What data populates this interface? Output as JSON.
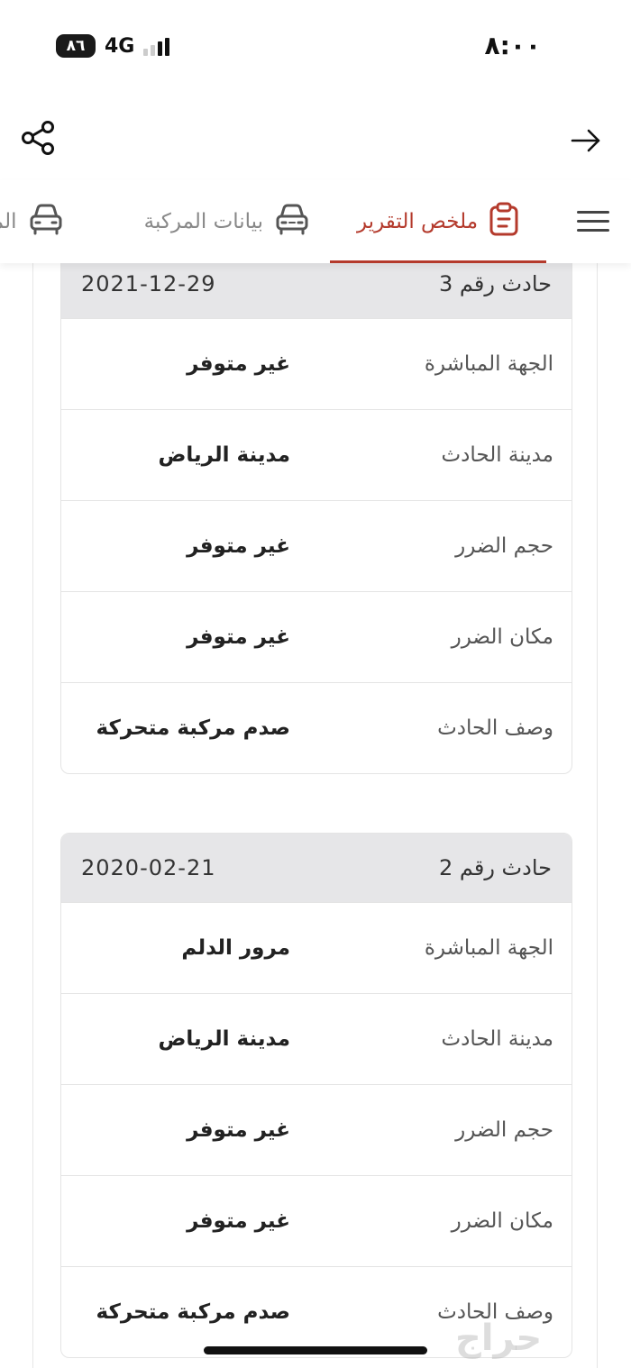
{
  "status_bar": {
    "time": "٨:٠٠",
    "battery": "٨٦",
    "network": "4G"
  },
  "header": {
    "share_icon": "share-icon",
    "back_icon": "arrow-right-icon"
  },
  "tabs": [
    {
      "label": "ملخص التقرير",
      "icon": "clipboard-icon",
      "active": true
    },
    {
      "label": "بيانات المركبة",
      "icon": "car-icon",
      "active": false
    },
    {
      "label": "المو",
      "icon": "car-icon",
      "active": false
    }
  ],
  "accent_color": "#b43a2c",
  "accidents": [
    {
      "title": "حادث رقم 3",
      "date": "2021-12-29",
      "rows": [
        {
          "label": "الجهة المباشرة",
          "value": "غير متوفر"
        },
        {
          "label": "مدينة الحادث",
          "value": "مدينة الرياض"
        },
        {
          "label": "حجم الضرر",
          "value": "غير متوفر"
        },
        {
          "label": "مكان الضرر",
          "value": "غير متوفر"
        },
        {
          "label": "وصف الحادث",
          "value": "صدم مركبة متحركة"
        }
      ]
    },
    {
      "title": "حادث رقم 2",
      "date": "2020-02-21",
      "rows": [
        {
          "label": "الجهة المباشرة",
          "value": "مرور الدلم"
        },
        {
          "label": "مدينة الحادث",
          "value": "مدينة الرياض"
        },
        {
          "label": "حجم الضرر",
          "value": "غير متوفر"
        },
        {
          "label": "مكان الضرر",
          "value": "غير متوفر"
        },
        {
          "label": "وصف الحادث",
          "value": "صدم مركبة متحركة"
        }
      ]
    }
  ],
  "watermark": "حراج"
}
